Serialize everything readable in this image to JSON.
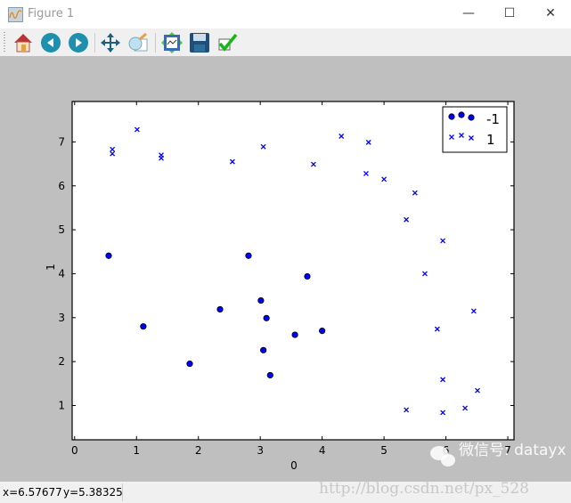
{
  "window": {
    "title": "Figure 1",
    "minimize": "—",
    "maximize": "☐",
    "close": "✕"
  },
  "toolbar": {
    "icons": [
      "home-icon",
      "back-icon",
      "forward-icon",
      "pan-icon",
      "zoom-icon",
      "subplots-icon",
      "save-icon",
      "edit-icon"
    ]
  },
  "status": {
    "x": "x=6.57677",
    "y": "y=5.38325"
  },
  "watermark": {
    "wechat": "微信号: datayx",
    "url": "http://blog.csdn.net/px_528"
  },
  "colors": {
    "marker": "#0000ff",
    "axes_bg": "#ffffff",
    "figure_bg": "#bfbfbf"
  },
  "chart_data": {
    "type": "scatter",
    "title": "",
    "xlabel": "0",
    "ylabel": "1",
    "xlim": [
      -0.04,
      7.1
    ],
    "ylim": [
      0.22,
      7.92
    ],
    "xticks": [
      0,
      1,
      2,
      3,
      4,
      5,
      6,
      7
    ],
    "yticks": [
      1,
      2,
      3,
      4,
      5,
      6,
      7
    ],
    "grid": false,
    "legend_position": "top-right",
    "series": [
      {
        "name": "-1",
        "marker": "circle",
        "x": [
          0.55,
          1.11,
          1.86,
          2.35,
          2.81,
          3.01,
          3.1,
          3.05,
          3.16,
          3.56,
          3.76,
          4.0
        ],
        "y": [
          4.41,
          2.8,
          1.95,
          3.19,
          4.41,
          3.39,
          2.99,
          2.26,
          1.69,
          2.61,
          3.94,
          2.7
        ]
      },
      {
        "name": "1",
        "marker": "x",
        "x": [
          0.61,
          0.61,
          1.01,
          1.4,
          1.4,
          2.55,
          3.05,
          4.31,
          4.75,
          3.86,
          4.71,
          5.0,
          5.5,
          5.36,
          5.95,
          5.66,
          6.45,
          5.86,
          5.95,
          6.51,
          5.36,
          5.95,
          6.31
        ],
        "y": [
          6.83,
          6.73,
          7.28,
          6.7,
          6.63,
          6.55,
          6.89,
          7.13,
          6.99,
          6.49,
          6.28,
          6.15,
          5.84,
          5.23,
          4.75,
          4.0,
          3.15,
          2.74,
          1.59,
          1.34,
          0.9,
          0.84,
          0.94
        ]
      }
    ]
  }
}
